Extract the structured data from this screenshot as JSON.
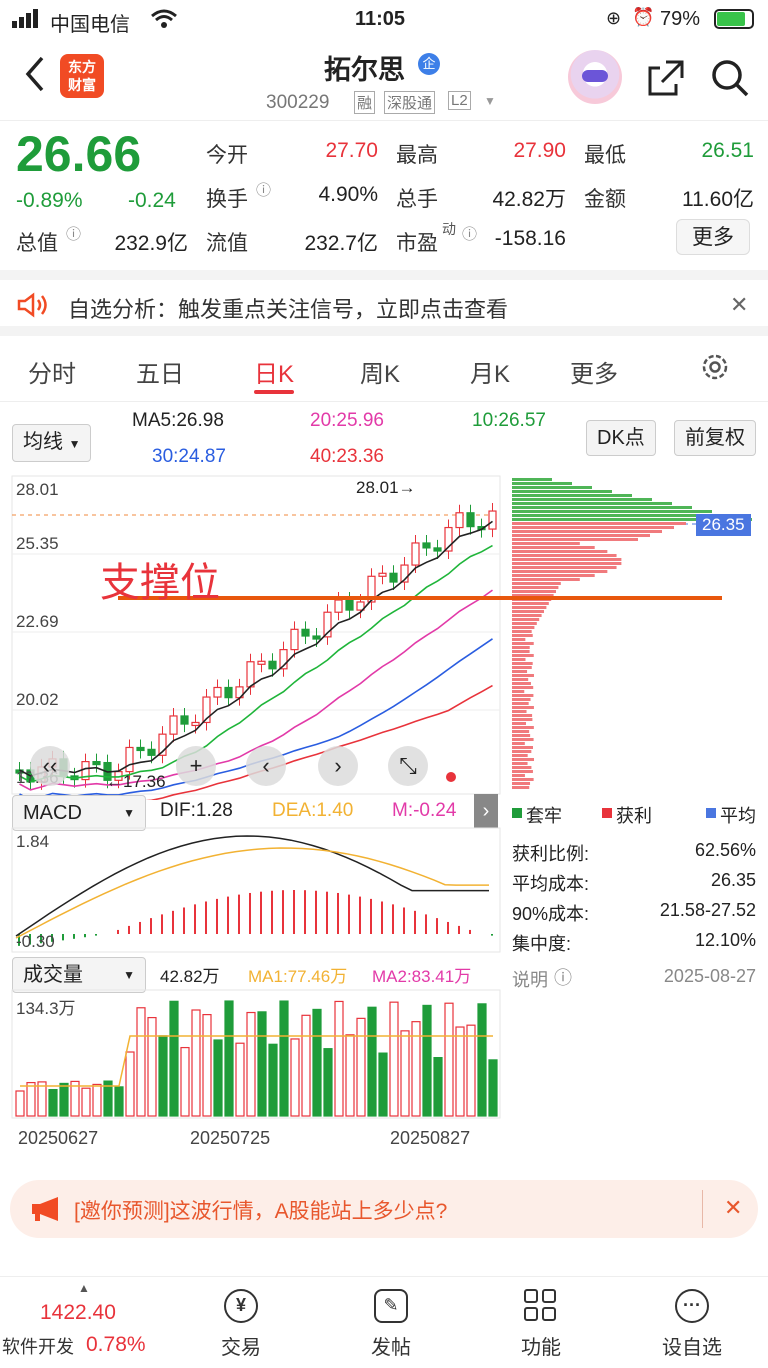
{
  "status_bar": {
    "carrier": "中国电信",
    "time": "11:05",
    "battery": "79%"
  },
  "header": {
    "logo_line1": "东方",
    "logo_line2": "财富",
    "stock_name": "拓尔思",
    "badge": "企",
    "code": "300229",
    "tags": [
      "融",
      "深股通",
      "L2"
    ]
  },
  "quote": {
    "price": "26.66",
    "change_pct": "-0.89%",
    "change": "-0.24",
    "open_label": "今开",
    "open": "27.70",
    "high_label": "最高",
    "high": "27.90",
    "low_label": "最低",
    "low": "26.51",
    "turnover_label": "换手",
    "turnover": "4.90%",
    "volume_label": "总手",
    "volume": "42.82万",
    "amount_label": "金额",
    "amount": "11.60亿",
    "mktcap_label": "总值",
    "mktcap": "232.9亿",
    "float_label": "流值",
    "float": "232.7亿",
    "pe_label": "市盈",
    "pe_sup": "动",
    "pe": "-158.16",
    "more": "更多"
  },
  "notice": {
    "text": "自选分析：触发重点关注信号，立即点击查看"
  },
  "tabs": [
    "分时",
    "五日",
    "日K",
    "周K",
    "月K",
    "更多"
  ],
  "active_tab": "日K",
  "kline": {
    "indicator": "均线",
    "ma5": "MA5:26.98",
    "ma20": "20:25.96",
    "ma10": "10:26.57",
    "ma30": "30:24.87",
    "ma40": "40:23.36",
    "dk_btn": "DK点",
    "adjust_btn": "前复权",
    "y_ticks": [
      "28.01",
      "25.35",
      "22.69",
      "20.02",
      "17.36"
    ],
    "max_label": "28.01→",
    "min_label": "←17.36",
    "annotation": "支撑位",
    "cost_price": "26.35"
  },
  "chips": {
    "legend": [
      "套牢",
      "获利",
      "平均"
    ],
    "rows": [
      {
        "label": "获利比例:",
        "value": "62.56%"
      },
      {
        "label": "平均成本:",
        "value": "26.35"
      },
      {
        "label": "90%成本:",
        "value": "21.58-27.52"
      },
      {
        "label": "集中度:",
        "value": "12.10%"
      }
    ],
    "note_label": "说明",
    "date": "2025-08-27"
  },
  "macd": {
    "name": "MACD",
    "dif": "DIF:1.28",
    "dea": "DEA:1.40",
    "m": "M:-0.24",
    "y_top": "1.84",
    "y_bottom": "-0.30"
  },
  "volume": {
    "name": "成交量",
    "vol": "42.82万",
    "ma1": "MA1:77.46万",
    "ma2": "MA2:83.41万",
    "y_top": "134.3万"
  },
  "dates": [
    "20250627",
    "20250725",
    "20250827"
  ],
  "banner": {
    "text": "[邀你预测]这波行情，A股能站上多少点?"
  },
  "bottom_nav": {
    "index_value": "1422.40",
    "index_name": "软件开发",
    "index_change": "0.78%",
    "items": [
      "交易",
      "发帖",
      "功能",
      "设自选"
    ]
  },
  "colors": {
    "up": "#e8333b",
    "down": "#1f9c3a",
    "accent": "#f14b24"
  }
}
